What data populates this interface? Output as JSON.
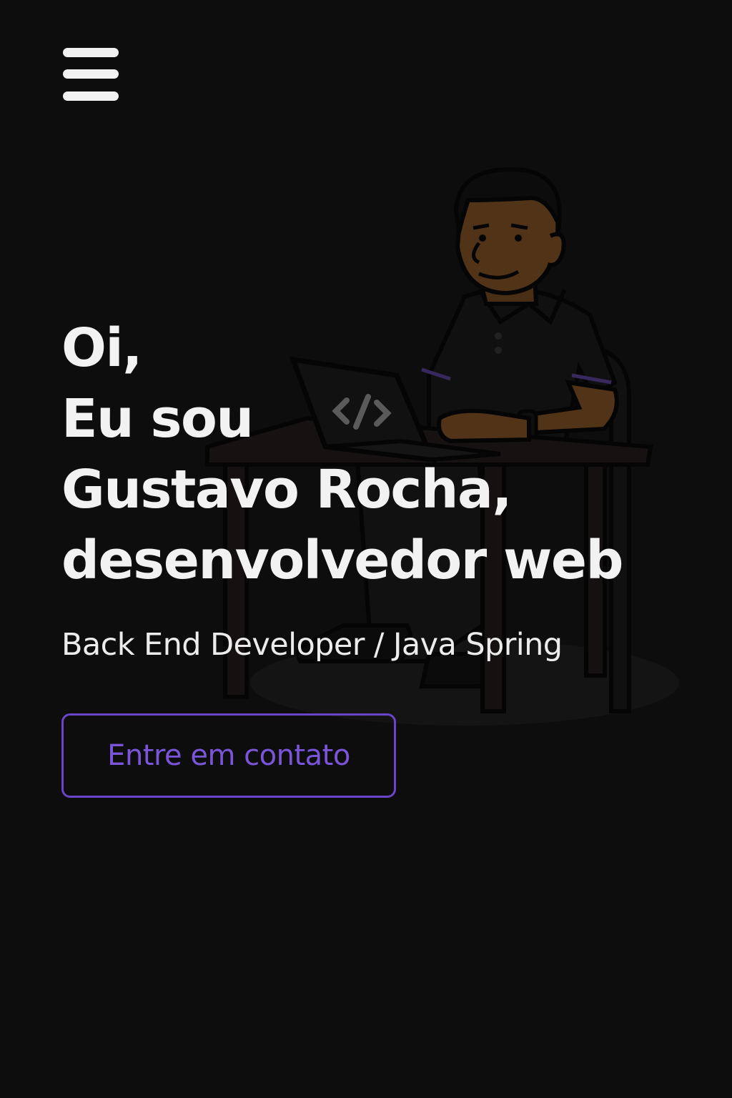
{
  "nav": {
    "menu_icon": "hamburger-menu-icon"
  },
  "hero": {
    "greeting": "Oi,",
    "intro": "Eu sou",
    "name": "Gustavo Rocha,",
    "role": "desenvolvedor web",
    "subtitle": "Back End Developer / Java Spring",
    "cta_label": "Entre em contato",
    "illustration": "developer-at-laptop-illustration",
    "laptop_icon": "code-brackets-icon"
  },
  "colors": {
    "background": "#0d0d0d",
    "text": "#f2f2f2",
    "accent": "#6a44c9"
  }
}
